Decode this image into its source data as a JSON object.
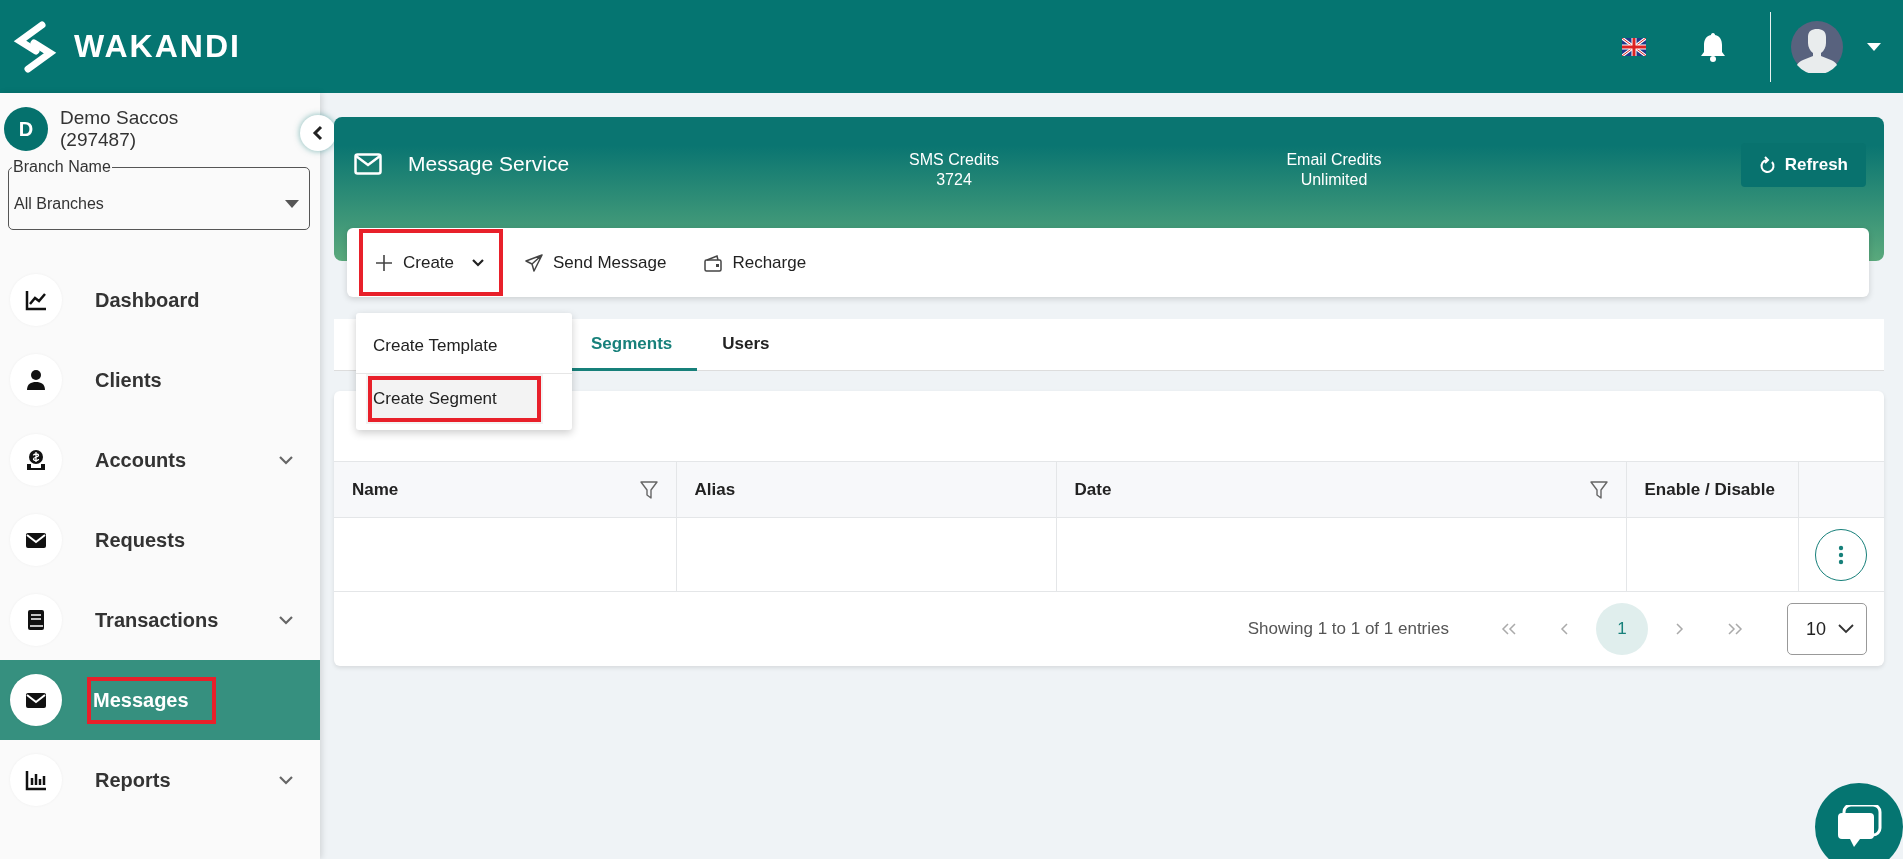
{
  "header": {
    "logo": "WAKANDI"
  },
  "sidebar": {
    "org_initial": "D",
    "org_name": "Demo Saccos",
    "org_code": "(297487)",
    "branch_select": {
      "label": "Branch Name",
      "value": "All Branches"
    },
    "items": [
      {
        "label": "Dashboard",
        "expandable": false,
        "selected": false,
        "highlighted": false
      },
      {
        "label": "Clients",
        "expandable": false,
        "selected": false,
        "highlighted": false
      },
      {
        "label": "Accounts",
        "expandable": true,
        "selected": false,
        "highlighted": false
      },
      {
        "label": "Requests",
        "expandable": false,
        "selected": false,
        "highlighted": false
      },
      {
        "label": "Transactions",
        "expandable": true,
        "selected": false,
        "highlighted": false
      },
      {
        "label": "Messages",
        "expandable": false,
        "selected": true,
        "highlighted": true
      },
      {
        "label": "Reports",
        "expandable": true,
        "selected": false,
        "highlighted": false
      }
    ]
  },
  "service": {
    "title": "Message Service",
    "credits": [
      {
        "label": "SMS Credits",
        "value": "3724"
      },
      {
        "label": "Email Credits",
        "value": "Unlimited"
      }
    ],
    "refresh_button": "Refresh"
  },
  "toolbar": [
    {
      "label": "Create",
      "kind": "dropdown",
      "highlighted": true,
      "expanded": true
    },
    {
      "label": "Send Message",
      "kind": "send",
      "highlighted": false
    },
    {
      "label": "Recharge",
      "kind": "wallet",
      "highlighted": false
    }
  ],
  "create_menu": [
    {
      "label": "Create Template",
      "hovered": false,
      "highlighted": false
    },
    {
      "label": "Create Segment",
      "hovered": true,
      "highlighted": true
    }
  ],
  "tabs": [
    {
      "label": "Segments",
      "selected": true
    },
    {
      "label": "Users",
      "selected": false
    }
  ],
  "table": {
    "columns": [
      {
        "label": "Name",
        "filter": true
      },
      {
        "label": "Alias",
        "filter": false
      },
      {
        "label": "Date",
        "filter": true
      },
      {
        "label": "Enable / Disable",
        "filter": false
      }
    ],
    "rows": [
      {
        "actions": true
      }
    ]
  },
  "pagination": {
    "summary": "Showing 1 to 1 of 1 entries",
    "pages": [
      {
        "label": "1",
        "selected": true
      }
    ],
    "page_size": "10"
  }
}
